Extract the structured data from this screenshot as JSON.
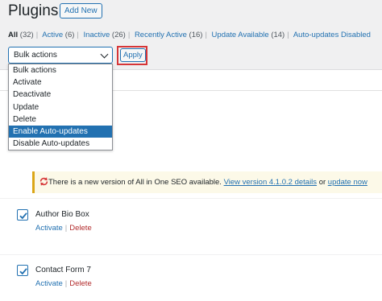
{
  "header": {
    "title": "Plugins",
    "add_new": "Add New"
  },
  "filters": {
    "all": "All",
    "all_count": "(32)",
    "active": "Active",
    "active_count": "(6)",
    "inactive": "Inactive",
    "inactive_count": "(26)",
    "recently_active": "Recently Active",
    "recently_active_count": "(16)",
    "update_available": "Update Available",
    "update_available_count": "(14)",
    "auto_updates_disabled": "Auto-updates Disabled"
  },
  "bulk": {
    "selected": "Bulk actions",
    "apply": "Apply",
    "options": [
      "Bulk actions",
      "Activate",
      "Deactivate",
      "Update",
      "Delete",
      "Enable Auto-updates",
      "Disable Auto-updates"
    ],
    "highlighted_option": "Enable Auto-updates"
  },
  "notice": {
    "text": "There is a new version of All in One SEO available.",
    "view_link": "View version 4.1.0.2 details",
    "or": "or",
    "update_link": "update now"
  },
  "plugins": [
    {
      "name": "Author Bio Box",
      "activate": "Activate",
      "delete": "Delete",
      "checked": true
    },
    {
      "name": "Contact Form 7",
      "activate": "Activate",
      "delete": "Delete",
      "checked": true
    }
  ],
  "colors": {
    "link": "#2271b1",
    "delete": "#b32d2e",
    "highlight": "#2271b1",
    "notice_border": "#dba617",
    "apply_outline": "#d63638"
  }
}
